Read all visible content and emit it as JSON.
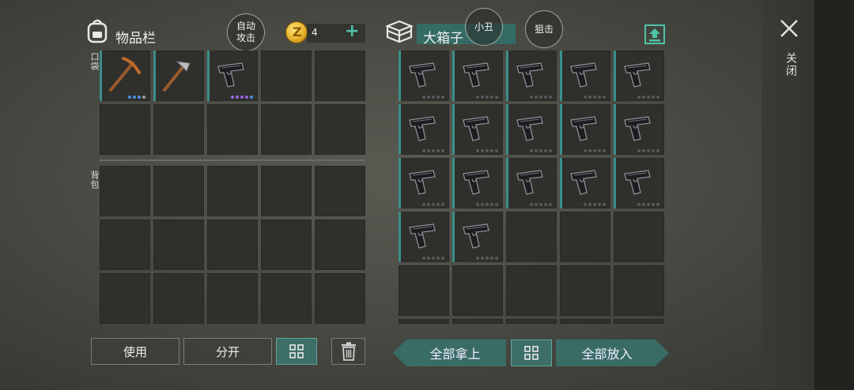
{
  "inventory": {
    "title": "物品栏",
    "auto_attack_label": "自动\n攻击",
    "coin_count": "4",
    "pocket_label": "口袋",
    "backpack_label": "背包",
    "pocket_items": [
      {
        "name": "pickaxe-icon",
        "rarity_dots": [
          "#4a8de6",
          "#4a8de6",
          "#4a8de6",
          "#9a9a9a"
        ]
      },
      {
        "name": "hammer-icon",
        "rarity_dots": []
      },
      {
        "name": "pistol-icon",
        "rarity_dots": [
          "#9a63e6",
          "#9a63e6",
          "#9a63e6",
          "#9a63e6",
          "#4a8de6"
        ]
      }
    ]
  },
  "chest": {
    "title": "大箱子",
    "clown_label": "小丑",
    "snipe_label": "狙击",
    "item_count": 17,
    "item_icon": "pistol-icon"
  },
  "buttons": {
    "use": "使用",
    "split": "分开",
    "take_all": "全部拿上",
    "put_all": "全部放入"
  },
  "close_label": "关闭",
  "colors": {
    "accent_teal": "#3b8f8a",
    "coin_gold": "#e6b22a",
    "plus_green": "#4fc3a8"
  }
}
